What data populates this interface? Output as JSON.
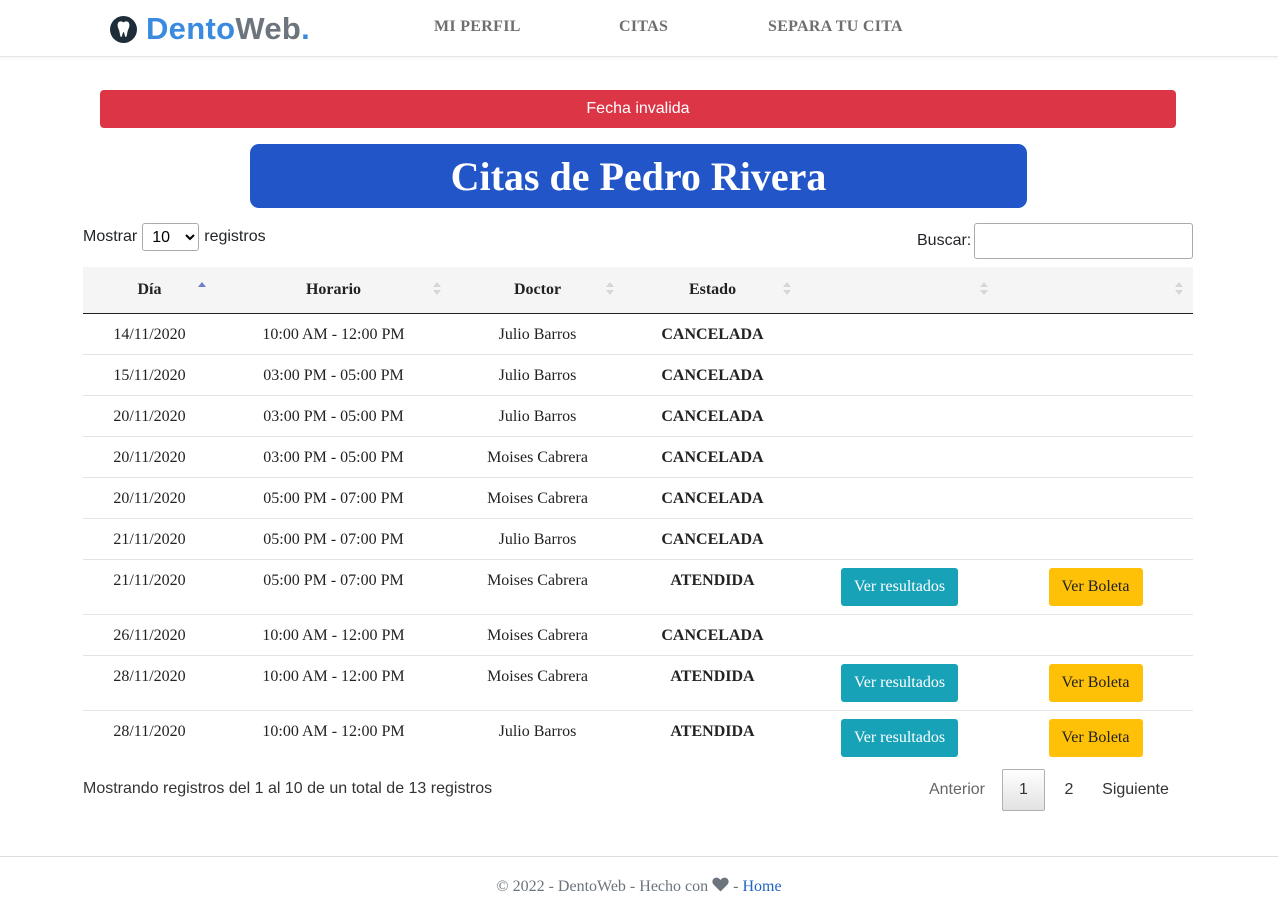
{
  "brand": {
    "part1": "Dento",
    "part2": "Web",
    "dot": ".",
    "icon": "tooth-icon"
  },
  "nav": {
    "items": [
      "MI PERFIL",
      "CITAS",
      "SEPARA TU CITA"
    ]
  },
  "alert": {
    "text": "Fecha invalida",
    "color": "#dc3545"
  },
  "title": "Citas de Pedro Rivera",
  "controls": {
    "show_label": "Mostrar",
    "show_value": "10",
    "records_label": "registros",
    "search_label": "Buscar:",
    "search_value": ""
  },
  "table": {
    "headers": [
      "Día",
      "Horario",
      "Doctor",
      "Estado",
      "",
      ""
    ],
    "sorted_column": "Día",
    "sort_direction": "asc",
    "rows": [
      {
        "dia": "14/11/2020",
        "horario": "10:00 AM - 12:00 PM",
        "doctor": "Julio Barros",
        "estado": "CANCELADA"
      },
      {
        "dia": "15/11/2020",
        "horario": "03:00 PM - 05:00 PM",
        "doctor": "Julio Barros",
        "estado": "CANCELADA"
      },
      {
        "dia": "20/11/2020",
        "horario": "03:00 PM - 05:00 PM",
        "doctor": "Julio Barros",
        "estado": "CANCELADA"
      },
      {
        "dia": "20/11/2020",
        "horario": "03:00 PM - 05:00 PM",
        "doctor": "Moises Cabrera",
        "estado": "CANCELADA"
      },
      {
        "dia": "20/11/2020",
        "horario": "05:00 PM - 07:00 PM",
        "doctor": "Moises Cabrera",
        "estado": "CANCELADA"
      },
      {
        "dia": "21/11/2020",
        "horario": "05:00 PM - 07:00 PM",
        "doctor": "Julio Barros",
        "estado": "CANCELADA"
      },
      {
        "dia": "21/11/2020",
        "horario": "05:00 PM - 07:00 PM",
        "doctor": "Moises Cabrera",
        "estado": "ATENDIDA",
        "btn_resultados": "Ver resultados",
        "btn_boleta": "Ver Boleta"
      },
      {
        "dia": "26/11/2020",
        "horario": "10:00 AM - 12:00 PM",
        "doctor": "Moises Cabrera",
        "estado": "CANCELADA"
      },
      {
        "dia": "28/11/2020",
        "horario": "10:00 AM - 12:00 PM",
        "doctor": "Moises Cabrera",
        "estado": "ATENDIDA",
        "btn_resultados": "Ver resultados",
        "btn_boleta": "Ver Boleta"
      },
      {
        "dia": "28/11/2020",
        "horario": "10:00 AM - 12:00 PM",
        "doctor": "Julio Barros",
        "estado": "ATENDIDA",
        "btn_resultados": "Ver resultados",
        "btn_boleta": "Ver Boleta"
      }
    ]
  },
  "info": "Mostrando registros del 1 al 10 de un total de 13 registros",
  "pagination": {
    "prev": "Anterior",
    "pages": [
      "1",
      "2"
    ],
    "current": "1",
    "next": "Siguiente"
  },
  "footer": {
    "text": "© 2022 - DentoWeb - Hecho con",
    "separator": "-",
    "link": "Home",
    "icon": "heart-icon"
  },
  "colors": {
    "cancelada": "#e60000",
    "atendida": "#5b92e0",
    "title_bg": "#2155c8",
    "btn_resultados": "#17a2b8",
    "btn_boleta": "#ffc107"
  }
}
